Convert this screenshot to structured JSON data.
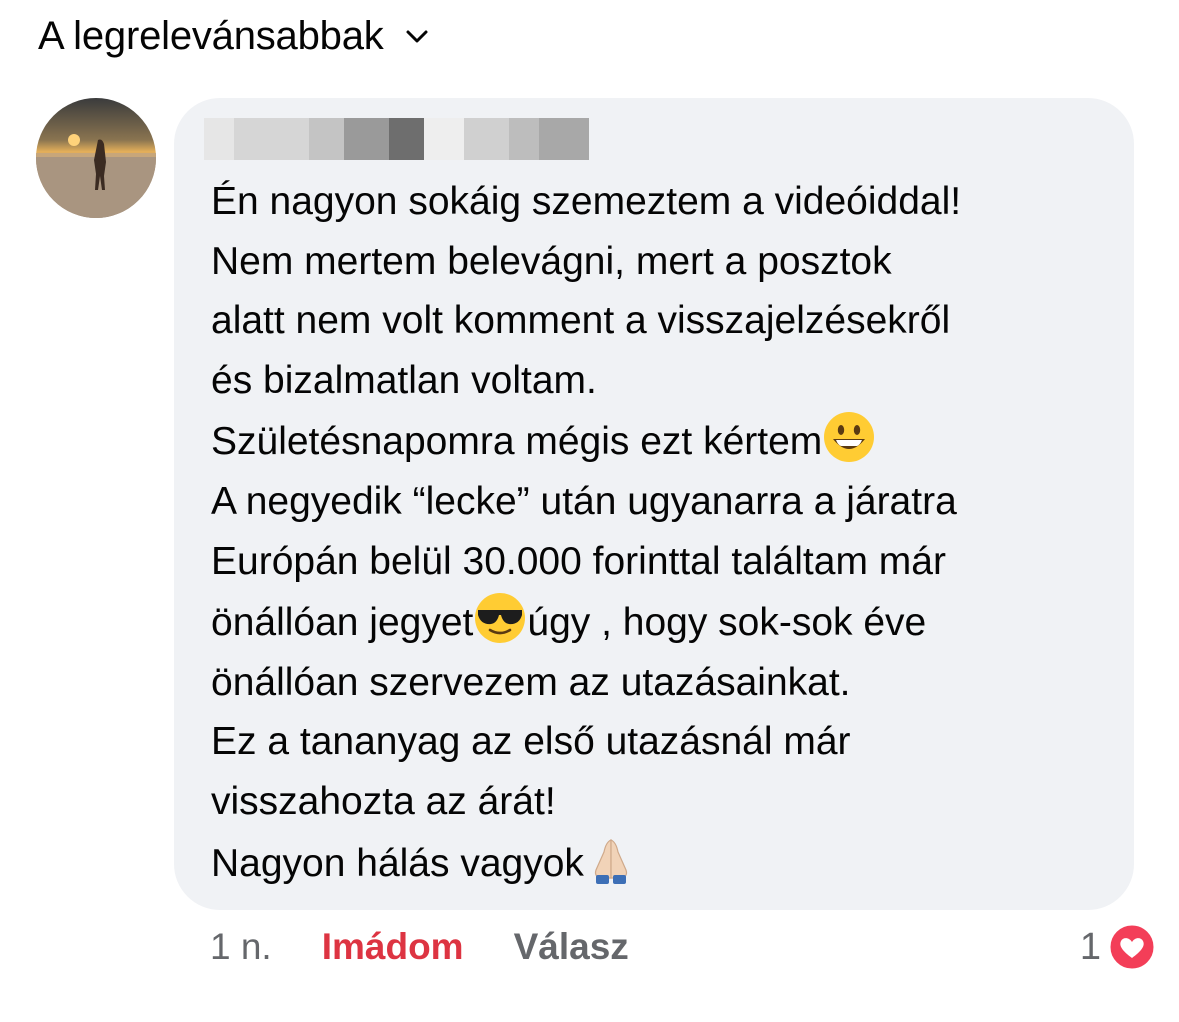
{
  "sort": {
    "label": "A legrelevánsabbak",
    "icon": "chevron-down-icon"
  },
  "comment": {
    "avatar": "profile-photo-beach-sunset",
    "author_redacted": true,
    "lines": [
      "Én nagyon sokáig szemeztem a videóiddal!",
      "Nem mertem belevágni, mert a posztok",
      "alatt nem volt komment a visszajelzésekről",
      "és bizalmatlan voltam.",
      "Születésnapomra mégis ezt kértem",
      "A negyedik “lecke” után ugyanarra a járatra",
      "Európán belül 30.000 forinttal találtam már",
      "önállóan jegyet",
      "úgy , hogy sok-sok éve",
      "önállóan szervezem az utazásainkat.",
      "Ez a tananyag az első utazásnál már",
      "visszahozta az árát!",
      "Nagyon hálás vagyok"
    ],
    "emojis": [
      "grinning-face-emoji",
      "sunglasses-face-emoji",
      "folded-hands-emoji"
    ]
  },
  "meta": {
    "time": "1 n.",
    "reaction": "Imádom",
    "reply": "Válasz",
    "reaction_count": "1",
    "reaction_icon": "heart-icon"
  },
  "colors": {
    "bubble": "#f0f2f5",
    "love": "#dd3442",
    "muted": "#65676b"
  }
}
